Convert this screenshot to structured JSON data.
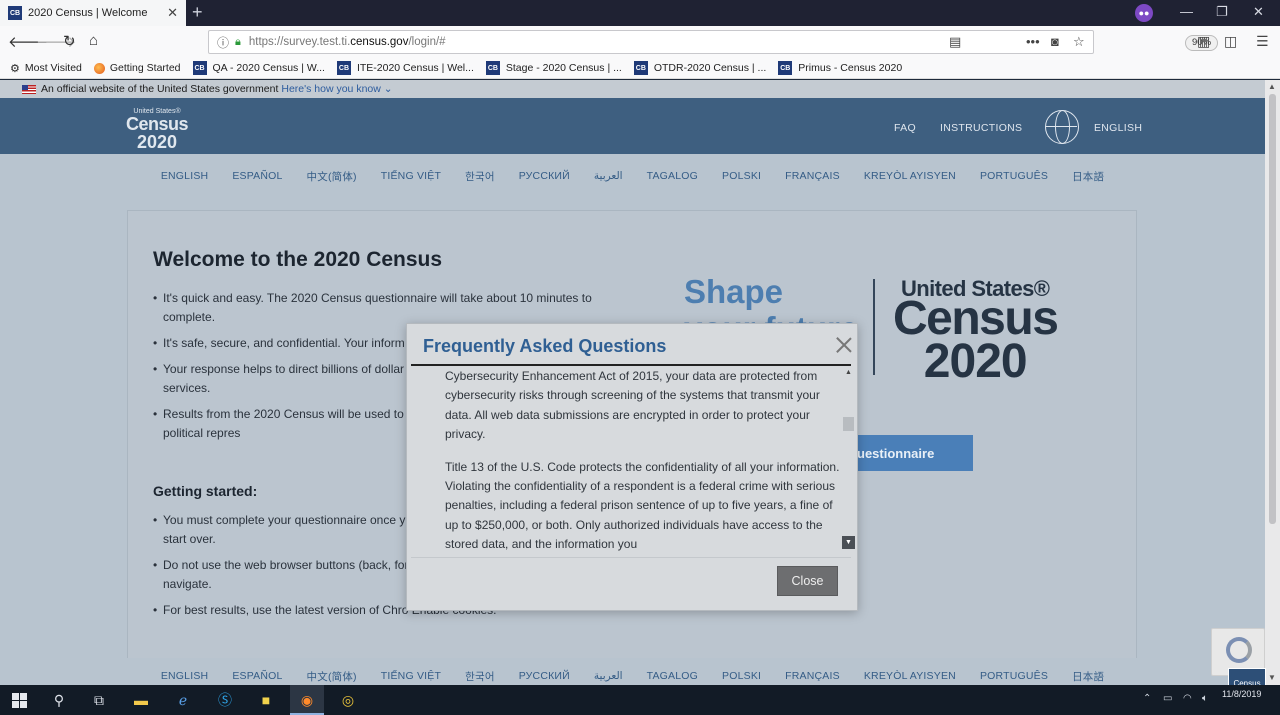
{
  "browser": {
    "tab_badge": "CB",
    "tab_title": "2020 Census | Welcome",
    "tab_close": "✕",
    "new_tab": "+",
    "url_prefix": "https://survey.test.ti.",
    "url_domain": "census.gov",
    "url_path": "/login/#",
    "zoom": "90%",
    "bookmarks": [
      {
        "label": "Most Visited",
        "icon": "gear-icon"
      },
      {
        "label": "Getting Started",
        "icon": "firefox-icon"
      },
      {
        "label": "QA - 2020 Census | W...",
        "icon": "CB"
      },
      {
        "label": "ITE-2020 Census | Wel...",
        "icon": "CB"
      },
      {
        "label": "Stage - 2020 Census | ...",
        "icon": "CB"
      },
      {
        "label": "OTDR-2020 Census | ...",
        "icon": "CB"
      },
      {
        "label": "Primus - Census 2020",
        "icon": "CB"
      }
    ]
  },
  "gov_banner": {
    "text": "An official website of the United States government",
    "link": "Here's how you know"
  },
  "header": {
    "logo_us": "United States®",
    "logo_census": "Census",
    "logo_year": "2020",
    "faq": "FAQ",
    "instructions": "INSTRUCTIONS",
    "language": "ENGLISH"
  },
  "languages": [
    "ENGLISH",
    "ESPAÑOL",
    "中文(简体)",
    "TIẾNG VIỆT",
    "한국어",
    "РУССКИЙ",
    "العربية",
    "TAGALOG",
    "POLSKI",
    "FRANÇAIS",
    "KREYÒL AYISYEN",
    "PORTUGUÊS",
    "日本語"
  ],
  "main": {
    "title": "Welcome to the 2020 Census",
    "bullets": [
      "It's quick and easy. The 2020 Census questionnaire will take about 10 minutes to complete.",
      "It's safe, secure, and confidential. Your inform",
      "Your response helps to direct billions of dollar for schools, roads, and other public services.",
      "Results from the 2020 Census will be used to d state has in Congress and your political repres"
    ],
    "started_title": "Getting started:",
    "started_bullets": [
      "You must complete your questionnaire once y and return later, you will have to start over.",
      "Do not use the web browser buttons (back, for buttons within the questionnaire to navigate.",
      "For best results, use the latest version of Chro Enable cookies."
    ],
    "shape_line1": "Shape",
    "shape_line2": "your future",
    "brand_us": "United States®",
    "brand_census": "Census",
    "brand_year": "2020",
    "start_button": "uestionnaire"
  },
  "modal": {
    "title": "Frequently Asked Questions",
    "paragraphs": [
      "Cybersecurity Enhancement Act of 2015, your data are protected from cybersecurity risks through screening of the systems that transmit your data. All web data submissions are encrypted in order to protect your privacy.",
      "Title 13 of the U.S. Code protects the confidentiality of all your information. Violating the confidentiality of a respondent is a federal crime with serious penalties, including a federal prison sentence of up to five years, a fine of up to $250,000, or both. Only authorized individuals have access to the stored data, and the information you"
    ],
    "close_button": "Close"
  },
  "taskbar": {
    "clock_date": "11/8/2019",
    "census_widget": "Census"
  }
}
